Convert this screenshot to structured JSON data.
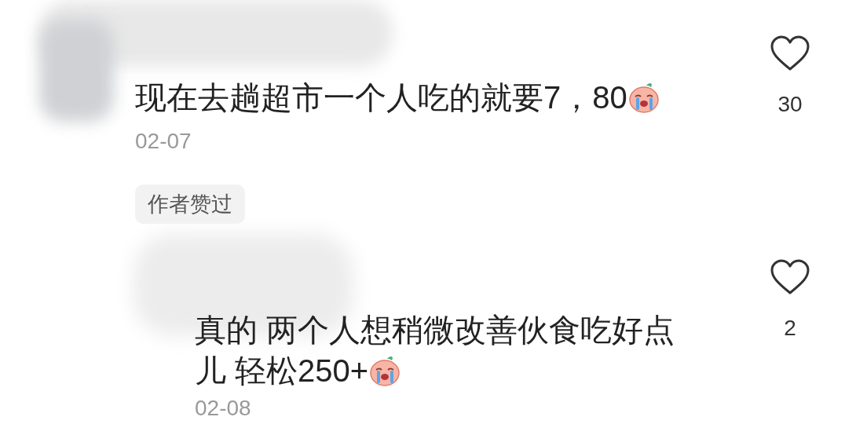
{
  "comments": [
    {
      "lines": [
        "现在去趟超市一个人吃的就要7，80"
      ],
      "date": "02-07",
      "likes": "30",
      "liked": false,
      "badge": "作者赞过",
      "replies": [
        {
          "lines": [
            "真的 两个人想稍微改善伙食吃好点",
            "儿 轻松250+"
          ],
          "date": "02-08",
          "likes": "2",
          "liked": false
        }
      ]
    }
  ]
}
